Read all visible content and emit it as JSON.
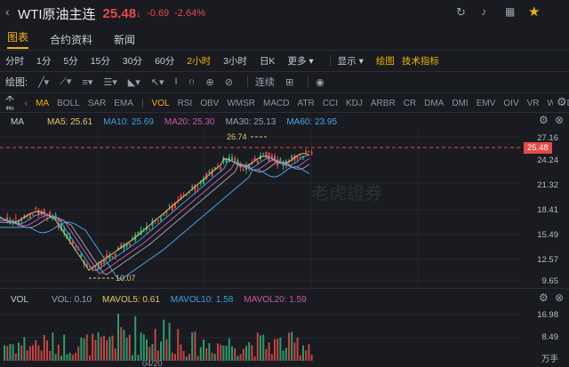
{
  "header": {
    "title": "WTI原油主连",
    "price": "25.48",
    "arrow": "↓",
    "change": "-0.69",
    "change_pct": "-2.64%",
    "icons": [
      "back-icon",
      "refresh-icon",
      "bell-icon",
      "grid-icon",
      "star-icon"
    ]
  },
  "tabs": [
    {
      "label": "图表",
      "active": true
    },
    {
      "label": "合约资料",
      "active": false
    },
    {
      "label": "新闻",
      "active": false
    }
  ],
  "timeframes": [
    {
      "label": "分时",
      "active": false
    },
    {
      "label": "1分",
      "active": false
    },
    {
      "label": "5分",
      "active": false
    },
    {
      "label": "15分",
      "active": false
    },
    {
      "label": "30分",
      "active": false
    },
    {
      "label": "60分",
      "active": false
    },
    {
      "label": "2小时",
      "active": true
    },
    {
      "label": "3小时",
      "active": false
    },
    {
      "label": "日K",
      "active": false
    },
    {
      "label": "更多",
      "active": false
    }
  ],
  "display_label": "显示",
  "draw_label": "绘图",
  "indicator_label": "技术指标",
  "draw_row": {
    "label": "绘图:",
    "continuous": "连续"
  },
  "indicator_row": {
    "label": "技术指标:",
    "items": [
      {
        "label": "MA",
        "active": true
      },
      {
        "label": "BOLL",
        "active": false
      },
      {
        "label": "SAR",
        "active": false
      },
      {
        "label": "EMA",
        "active": false
      },
      {
        "label": "VOL",
        "active": true
      },
      {
        "label": "RSI",
        "active": false
      },
      {
        "label": "OBV",
        "active": false
      },
      {
        "label": "WMSR",
        "active": false
      },
      {
        "label": "MACD",
        "active": false
      },
      {
        "label": "ATR",
        "active": false
      },
      {
        "label": "CCI",
        "active": false
      },
      {
        "label": "KDJ",
        "active": false
      },
      {
        "label": "ARBR",
        "active": false
      },
      {
        "label": "CR",
        "active": false
      },
      {
        "label": "DMA",
        "active": false
      },
      {
        "label": "DMI",
        "active": false
      },
      {
        "label": "EMV",
        "active": false
      },
      {
        "label": "OIV",
        "active": false
      },
      {
        "label": "VR",
        "active": false
      },
      {
        "label": "WVAD",
        "active": false
      }
    ]
  },
  "ma_legend": {
    "name": "MA",
    "items": [
      {
        "label": "MA5: 25.61",
        "color": "#e8c46a"
      },
      {
        "label": "MA10: 25.69",
        "color": "#3aa0d8"
      },
      {
        "label": "MA20: 25.30",
        "color": "#c45aa8"
      },
      {
        "label": "MA30: 25.13",
        "color": "#9aa0aa"
      },
      {
        "label": "MA60: 23.95",
        "color": "#4aa3e0"
      }
    ]
  },
  "vol_legend": {
    "name": "VOL",
    "items": [
      {
        "label": "VOL: 0.10",
        "color": "#9aa0aa"
      },
      {
        "label": "MAVOL5: 0.61",
        "color": "#e8c46a"
      },
      {
        "label": "MAVOL10: 1.58",
        "color": "#3aa0d8"
      },
      {
        "label": "MAVOL20: 1.59",
        "color": "#c45aa8"
      }
    ]
  },
  "price_axis": [
    "27.16",
    "24.24",
    "21.32",
    "18.41",
    "15.49",
    "12.57",
    "9.65"
  ],
  "current_price_tag": "25.48",
  "vol_axis": [
    "16.98",
    "8.49",
    "万手"
  ],
  "annotations": {
    "high": "26.74",
    "low": "10.07"
  },
  "watermark": "老虎證券",
  "date_label": "04/20"
}
